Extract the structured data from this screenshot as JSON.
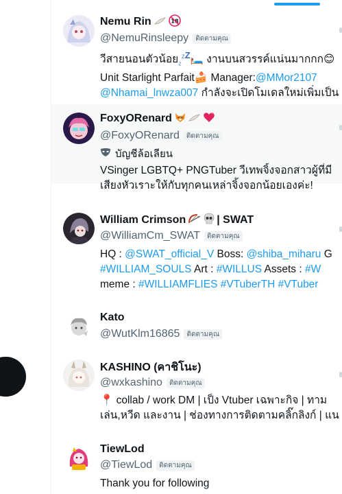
{
  "users": [
    {
      "name": "Nemu Rin",
      "name_emojis": [
        "feather-icon",
        "18-plus-icon"
      ],
      "handle": "@NemuRinsleepy",
      "follows_you": "ติดตามคุณ",
      "bio_lines": [
        [
          {
            "t": "วีสายนอนตัวน้อย"
          },
          {
            "t": "z",
            "sub": true
          },
          {
            "t": "z",
            "sup": true
          },
          {
            "t": "Z",
            "sup2": true
          },
          {
            "t": "🛏️ งานบนสวรรค์แน่นมากกก😊"
          }
        ],
        [
          {
            "t": "Unit Starlight Parfait🍰 Manager:"
          },
          {
            "t": "@MMor2107",
            "link": true
          }
        ],
        [
          {
            "t": "@Nhamai_lnwza007",
            "link": true
          },
          {
            "t": " กำลังจะเปิดโมเดลใหม่เพิ่มเป็น"
          }
        ]
      ]
    },
    {
      "name": "FoxyORenard",
      "name_emojis": [
        "fox-icon",
        "feather-icon",
        "heart-icon"
      ],
      "handle": "@FoxyORenard",
      "follows_you": "ติดตามคุณ",
      "parody_label": "บัญชีล้อเลียน",
      "bio_lines": [
        [
          {
            "t": "VSinger LGBTQ+ PNGTuber วีเทพจิ้งจอกสาวผู้ที่มี"
          }
        ],
        [
          {
            "t": "เสียงหัวเราะให้กับทุกคนเหล่าจิ้งจอกน้อยเองค่ะ!"
          }
        ]
      ]
    },
    {
      "name": "William Crimson",
      "name_suffix": "| SWAT",
      "name_emojis": [
        "bow-arrow-icon",
        "skull-icon"
      ],
      "handle": "@WilliamCm_SWAT",
      "follows_you": "ติดตามคุณ",
      "bio_lines": [
        [
          {
            "t": "HQ : "
          },
          {
            "t": "@SWAT_official_V",
            "link": true
          },
          {
            "t": " Boss: "
          },
          {
            "t": "@shiba_miharu",
            "link": true
          },
          {
            "t": " G"
          }
        ],
        [
          {
            "t": "#WILLIAM_SOULS",
            "link": true
          },
          {
            "t": " Art : "
          },
          {
            "t": "#WILLUS",
            "link": true
          },
          {
            "t": " Assets : "
          },
          {
            "t": "#W",
            "link": true
          }
        ],
        [
          {
            "t": "meme : "
          },
          {
            "t": "#WILLIAMFLIES",
            "link": true
          },
          {
            "t": " "
          },
          {
            "t": "#VTuberTH",
            "link": true
          },
          {
            "t": " "
          },
          {
            "t": "#VTuber",
            "link": true
          }
        ]
      ]
    },
    {
      "name": "Kato",
      "handle": "@WutKlm16865",
      "follows_you": "ติดตามคุณ",
      "bio_lines": []
    },
    {
      "name": "KASHINO (คาชิโนะ)",
      "handle": "@wxkashino",
      "follows_you": "ติดตามคุณ",
      "bio_lines": [
        [
          {
            "t": "📍 collab / work DM | เป็ง Vtuber เฉพาะกิจ | ทาม"
          }
        ],
        [
          {
            "t": "เล่น,หวีด และงาน | ช่องทางการติดตามคลิ๊กลิงก์ | แน"
          }
        ]
      ]
    },
    {
      "name": "TiewLod",
      "handle": "@TiewLod",
      "follows_you": "ติดตามคุณ",
      "bio_lines": [
        [
          {
            "t": "Thank you for following"
          }
        ]
      ]
    }
  ],
  "colors": {
    "link": "#1d9bf0",
    "secondary_text": "#536471",
    "highlight_row": "#f7f9f9",
    "divider": "#eff3f4"
  }
}
